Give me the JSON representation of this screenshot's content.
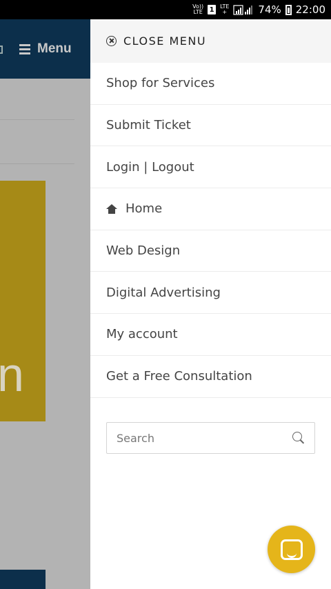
{
  "status_bar": {
    "volte": "Vo))\nLTE",
    "sim_slot": "1",
    "lte_plus": "LTE\n+",
    "battery_percent": "74%",
    "time": "22:00"
  },
  "background_page": {
    "menu_label": "Menu",
    "banner_partial_text": "n"
  },
  "drawer": {
    "close_label": "CLOSE MENU",
    "items": [
      {
        "label": "Shop for Services",
        "icon": null
      },
      {
        "label": "Submit Ticket",
        "icon": null
      },
      {
        "label": "Login | Logout",
        "icon": null
      },
      {
        "label": "Home",
        "icon": "home-icon"
      },
      {
        "label": "Web Design",
        "icon": null
      },
      {
        "label": "Digital Advertising",
        "icon": null
      },
      {
        "label": "My account",
        "icon": null
      },
      {
        "label": "Get a Free Consultation",
        "icon": null
      }
    ],
    "search": {
      "placeholder": "Search",
      "value": ""
    }
  },
  "colors": {
    "header_navy": "#0c2f4b",
    "banner_gold": "#a68a17",
    "chat_yellow": "#e5b51a",
    "overlay_gray": "#b3b3b3"
  }
}
